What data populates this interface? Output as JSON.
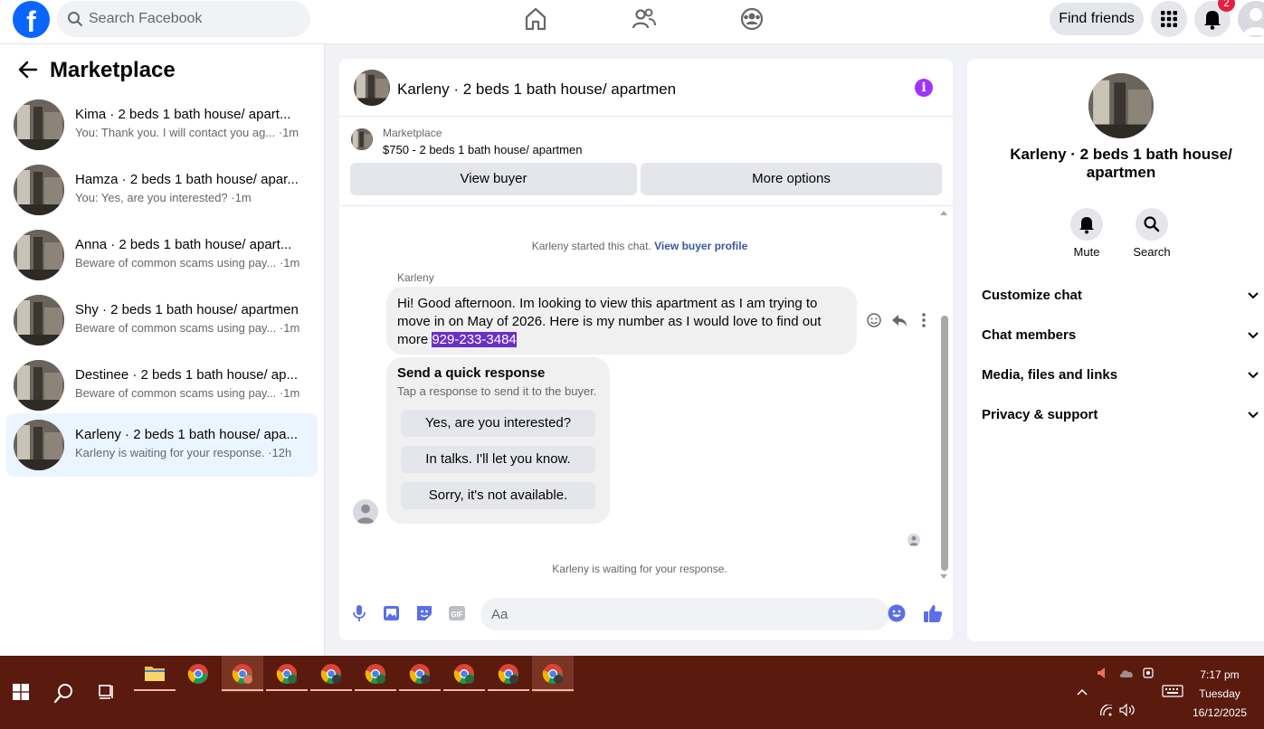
{
  "topbar": {
    "search_placeholder": "Search Facebook",
    "find_friends_label": "Find friends",
    "notifications_count": "2"
  },
  "sidebar": {
    "title": "Marketplace",
    "conversations": [
      {
        "name": "Kima · 2 beds 1 bath house/ apart...",
        "snippet": "You: Thank you. I will contact you ag... ·1m"
      },
      {
        "name": "Hamza · 2 beds 1 bath house/ apar...",
        "snippet": "You: Yes, are you interested? ·1m"
      },
      {
        "name": "Anna · 2 beds 1 bath house/ apart...",
        "snippet": "Beware of common scams using pay... ·1m"
      },
      {
        "name": "Shy · 2 beds 1 bath house/ apartmen",
        "snippet": "Beware of common scams using pay... ·1m"
      },
      {
        "name": "Destinee · 2 beds 1 bath house/ ap...",
        "snippet": "Beware of common scams using pay... ·1m"
      },
      {
        "name": "Karleny · 2 beds 1 bath house/ apa...",
        "snippet": "Karleny is waiting for your response. ·12h"
      }
    ]
  },
  "chat": {
    "title": "Karleny · 2 beds 1 bath house/ apartmen",
    "listing_label": "Marketplace",
    "listing_title": "$750 - 2 beds 1 bath house/ apartmen",
    "view_buyer_label": "View buyer",
    "more_options_label": "More options",
    "started_text": "Karleny started this chat.",
    "view_profile_link": "View buyer profile",
    "sender_name": "Karleny",
    "message_text": "Hi! Good afternoon. Im looking to view this apartment as I am trying to move in on May of 2026. Here is my number as I would love to find out more ",
    "message_phone": "929-233-3484",
    "quick_title": "Send a quick response",
    "quick_subtitle": "Tap a response to send it to the buyer.",
    "quick_responses": [
      "Yes, are you interested?",
      "In talks. I'll let you know.",
      "Sorry, it's not available."
    ],
    "waiting_text": "Karleny is waiting for your response.",
    "composer_placeholder": "Aa"
  },
  "right_panel": {
    "name": "Karleny · 2 beds 1 bath house/ apartmen",
    "mute_label": "Mute",
    "search_label": "Search",
    "sections": [
      "Customize chat",
      "Chat members",
      "Media, files and links",
      "Privacy & support"
    ]
  },
  "taskbar": {
    "time": "7:17 pm",
    "day": "Tuesday",
    "date": "16/12/2025"
  },
  "colors": {
    "facebook_blue": "#0866ff",
    "messenger_purple": "#a033ff",
    "taskbar_bg": "#5a1a0e",
    "notification_red": "#e41e3f",
    "active_conversation_bg": "#ebf5ff"
  }
}
